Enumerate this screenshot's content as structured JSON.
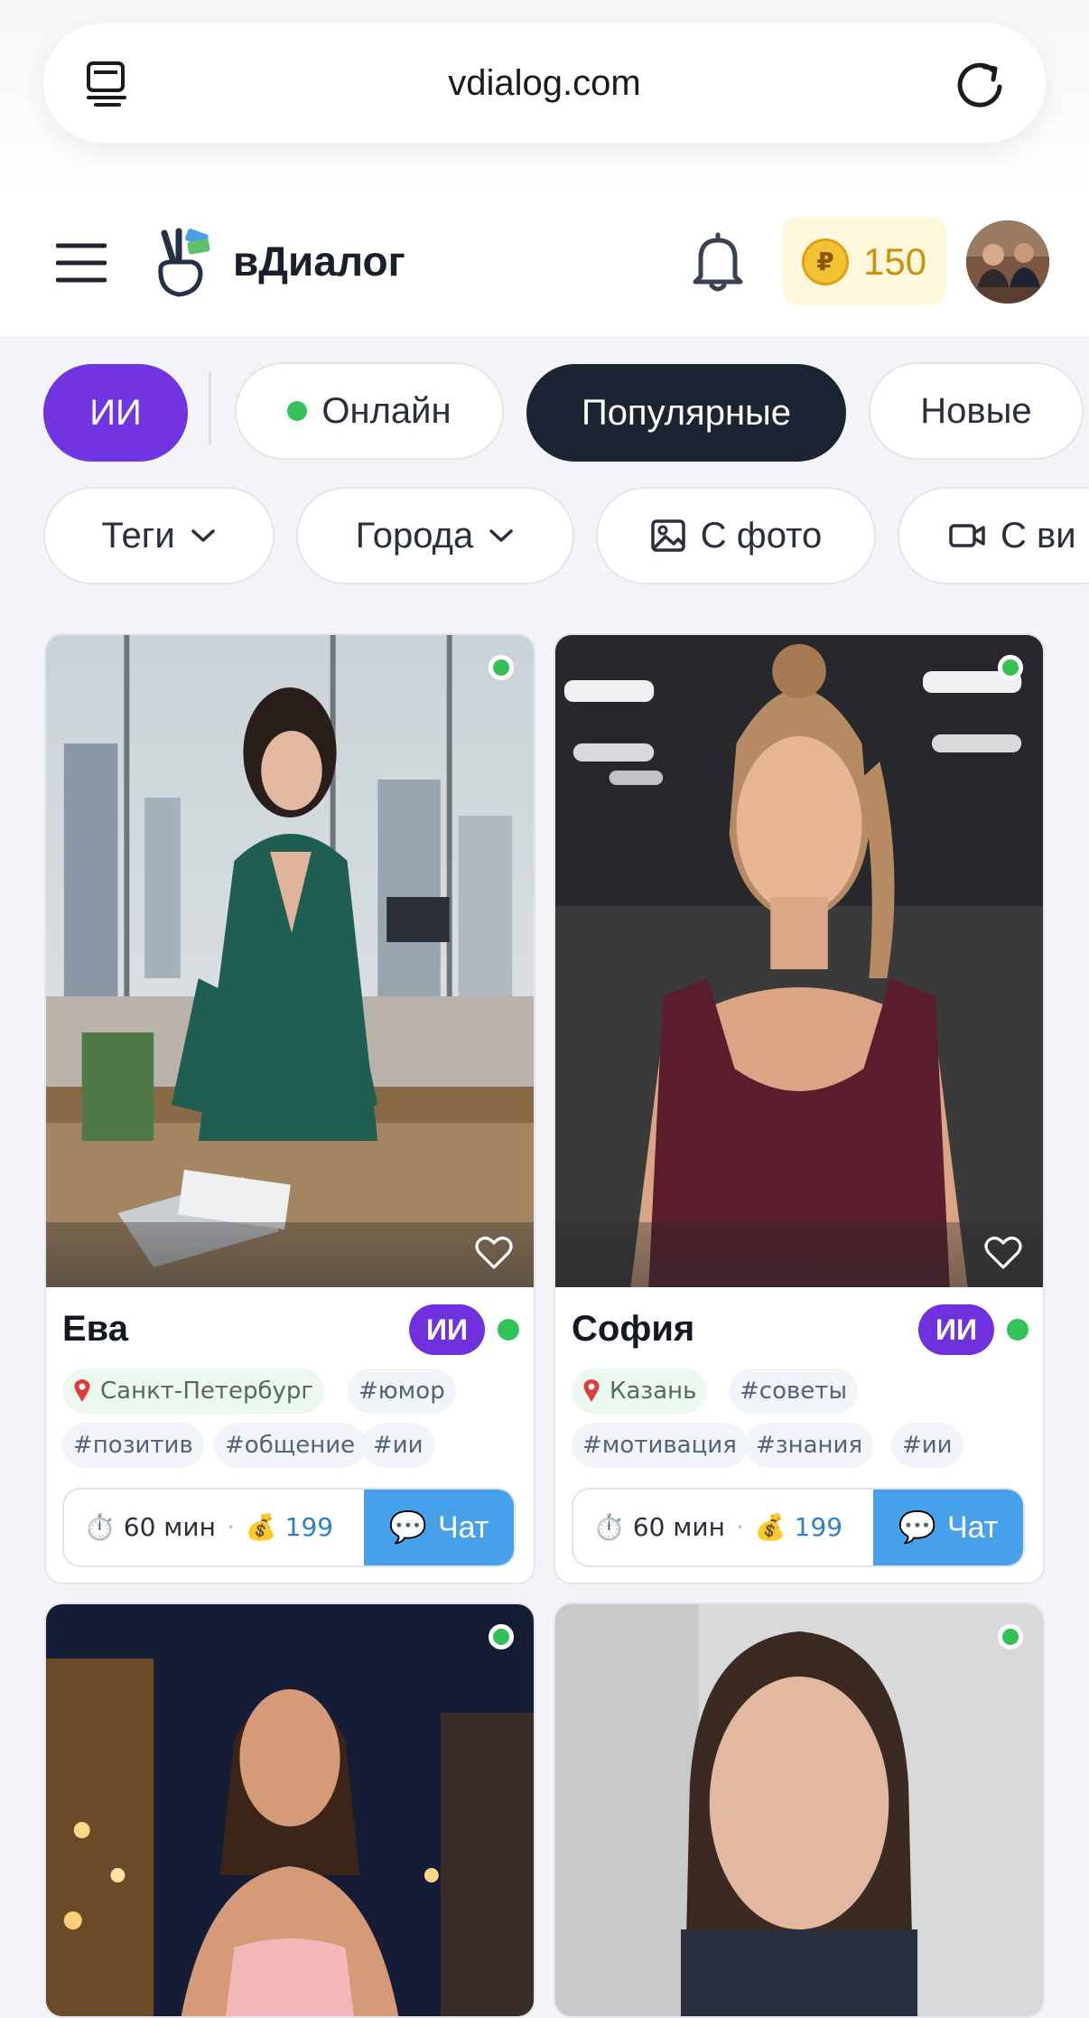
{
  "browser": {
    "url": "vdialog.com"
  },
  "header": {
    "brand": "вДиалог",
    "coins": "150",
    "coin_symbol": "₽"
  },
  "filters": {
    "row1": {
      "ai": "ИИ",
      "online": "Онлайн",
      "popular": "Популярные",
      "new": "Новые"
    },
    "row2": {
      "tags": "Теги",
      "cities": "Города",
      "with_photo": "С фото",
      "with_video": "С ви"
    }
  },
  "cards": [
    {
      "name": "Ева",
      "badge": "ИИ",
      "city": "Санкт-Петербург",
      "tags": [
        "#юмор",
        "#позитив",
        "#общение",
        "#ии"
      ],
      "duration": "60 мин",
      "price": "199",
      "chat": "Чат"
    },
    {
      "name": "София",
      "badge": "ИИ",
      "city": "Казань",
      "tags": [
        "#советы",
        "#мотивация",
        "#знания",
        "#ии"
      ],
      "duration": "60 мин",
      "price": "199",
      "chat": "Чат"
    }
  ],
  "icons": {
    "duration_emoji": "⏱️",
    "price_emoji": "💰",
    "chat_emoji": "💬"
  }
}
